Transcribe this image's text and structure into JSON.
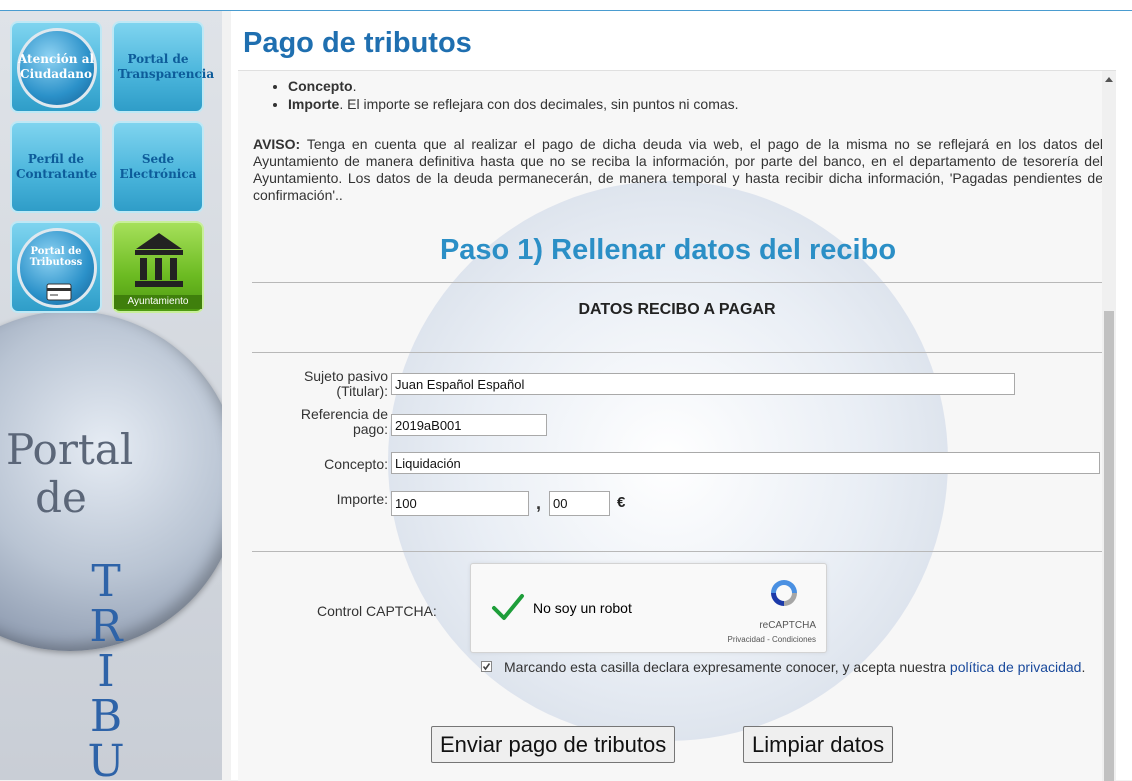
{
  "sidebar": {
    "tiles": {
      "atencion": "Atención al Ciudadano",
      "transparencia": "Portal de Transparencia",
      "contratante": "Perfil de Contratante",
      "sede": "Sede Electrónica",
      "tributos": "Portal de Tributoss",
      "ayuntamiento": "Ayuntamiento"
    },
    "portal_word": "Portal",
    "de_word": "de",
    "vertical_letters": [
      "T",
      "R",
      "I",
      "B",
      "U"
    ]
  },
  "main": {
    "title": "Pago de tributos",
    "bullets": [
      {
        "bold": "Concepto",
        "text": "."
      },
      {
        "bold": "Importe",
        "text": ". El importe se reflejara con dos decimales, sin puntos ni comas."
      }
    ],
    "aviso_label": "AVISO:",
    "aviso_text": " Tenga en cuenta que al realizar el pago de dicha deuda via web, el pago de la misma no se reflejará en los datos del Ayuntamiento de manera definitiva hasta que no se reciba la información, por parte del banco, en el departamento de tesorería del Ayuntamiento. Los datos de la deuda permanecerán, de manera temporal y hasta recibir dicha información, 'Pagadas pendientes de confirmación'..",
    "step_title": "Paso 1) Rellenar datos del recibo",
    "section_title": "DATOS RECIBO A PAGAR"
  },
  "form": {
    "sujeto_label_1": "Sujeto pasivo",
    "sujeto_label_2": "(Titular):",
    "sujeto_value": "Juan Español Español",
    "referencia_label_1": "Referencia de",
    "referencia_label_2": "pago:",
    "referencia_value": "2019aB001",
    "concepto_label": "Concepto:",
    "concepto_value": "Liquidación",
    "importe_label": "Importe:",
    "importe_entero": "100",
    "comma": ",",
    "importe_decimal": "00",
    "currency": "€"
  },
  "captcha": {
    "label": "Control CAPTCHA:",
    "text": "No soy un robot",
    "brand": "reCAPTCHA",
    "links": "Privacidad - Condiciones"
  },
  "consent": {
    "text": "Marcando esta casilla declara expresamente conocer, y acepta nuestra ",
    "link": "política de privacidad",
    "end": ".",
    "checked": true
  },
  "buttons": {
    "submit": "Enviar pago de tributos",
    "clear": "Limpiar datos"
  }
}
